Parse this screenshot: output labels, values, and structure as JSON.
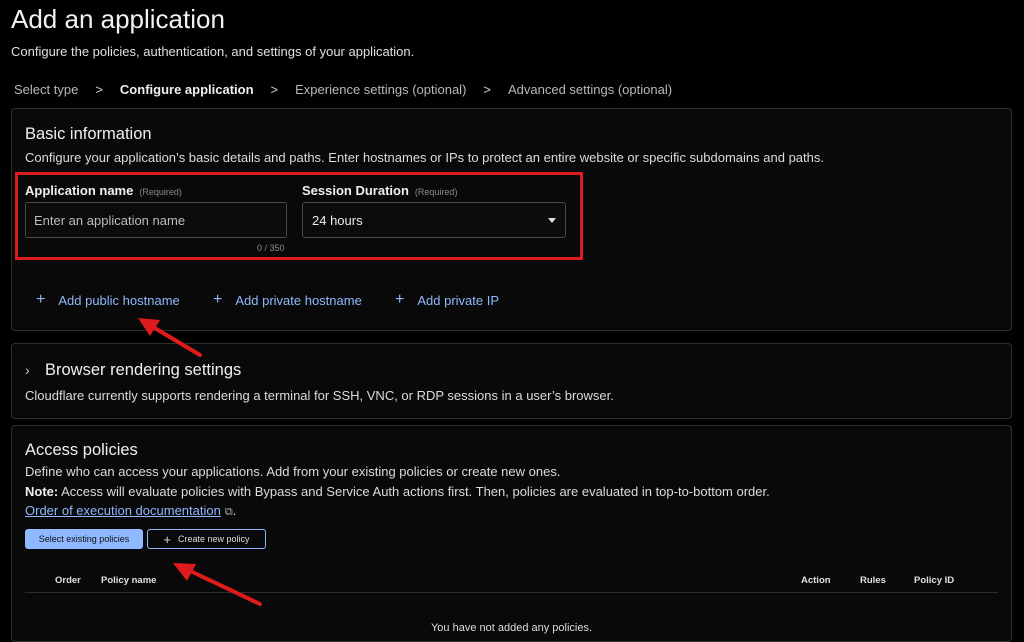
{
  "header": {
    "title": "Add an application",
    "subtitle": "Configure the policies, authentication, and settings of your application."
  },
  "steps": [
    {
      "label": "Select type"
    },
    {
      "label": "Configure application"
    },
    {
      "label": "Experience settings (optional)"
    },
    {
      "label": "Advanced settings (optional)"
    }
  ],
  "step_separator": ">",
  "basic": {
    "title": "Basic information",
    "description": "Configure your application’s basic details and paths. Enter hostnames or IPs to protect an entire website or specific subdomains and paths.",
    "app_name_label": "Application name",
    "app_name_required": "(Required)",
    "app_name_placeholder": "Enter an application name",
    "app_name_value": "",
    "counter": "0 / 350",
    "session_label": "Session Duration",
    "session_required": "(Required)",
    "session_value": "24 hours",
    "add_public": "Add public hostname",
    "add_private": "Add private hostname",
    "add_ip": "Add private IP",
    "plus": "+"
  },
  "browser": {
    "chevron": "›",
    "title": "Browser rendering settings",
    "description": "Cloudflare currently supports rendering a terminal for SSH, VNC, or RDP sessions in a user’s browser."
  },
  "access": {
    "title": "Access policies",
    "description": "Define who can access your applications. Add from your existing policies or create new ones.",
    "note_label": "Note:",
    "note_text": " Access will evaluate policies with Bypass and Service Auth actions first. Then, policies are evaluated in top-to-bottom order.",
    "doc_link": "Order of execution documentation",
    "doc_link_suffix": ".",
    "ext_icon": "⧉",
    "select_button": "Select existing policies",
    "create_button": "Create new policy",
    "create_plus": "+",
    "columns": {
      "order": "Order",
      "policy_name": "Policy name",
      "action": "Action",
      "rules": "Rules",
      "policy_id": "Policy ID"
    },
    "empty_text": "You have not added any policies."
  },
  "colors": {
    "accent": "#8fb8ff",
    "annotation_red": "#e01b1b",
    "background": "#000000"
  }
}
